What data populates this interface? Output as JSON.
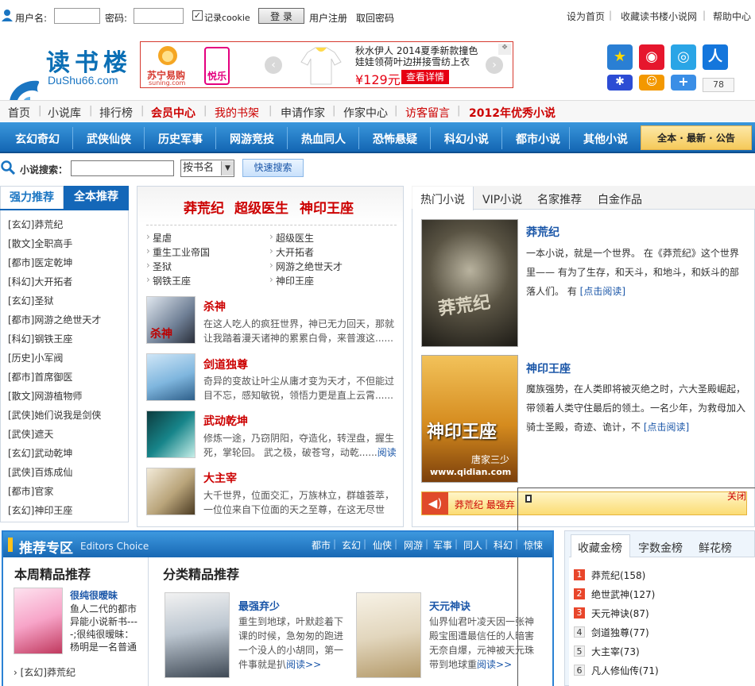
{
  "login": {
    "username_label": "用户名:",
    "password_label": "密码:",
    "remember_label": "记录cookie",
    "login_button": "登 录",
    "register_link": "用户注册",
    "forgot_link": "取回密码",
    "set_home": "设为首页",
    "bookmark": "收藏读书楼小说网",
    "help": "帮助中心"
  },
  "logo": {
    "text": "读书楼",
    "sub": "DuShu66.com"
  },
  "ad": {
    "brand": "苏宁易购",
    "brand_sub": "suning.com",
    "badge": "悦乐",
    "line1": "秋水伊人 2014夏季新款撞色",
    "line2": "娃娃领荷叶边拼接雪纺上衣",
    "price": "¥129元",
    "detail_button": "查看详情"
  },
  "social_count": "78",
  "nav_main": [
    "首页",
    "小说库",
    "排行榜",
    "会员中心",
    "我的书架",
    "申请作家",
    "作家中心",
    "访客留言",
    "2012年优秀小说"
  ],
  "nav_categories": [
    "玄幻奇幻",
    "武侠仙侠",
    "历史军事",
    "网游竞技",
    "热血同人",
    "恐怖悬疑",
    "科幻小说",
    "都市小说",
    "其他小说"
  ],
  "nav_right": "全本 · 最新 · 公告",
  "search": {
    "label": "小说搜索：",
    "select_value": "按书名",
    "button": "快速搜索"
  },
  "left_tabs": [
    "强力推荐",
    "全本推荐"
  ],
  "left_list": [
    "[玄幻]莽荒纪",
    "[散文]全职高手",
    "[都市]医定乾坤",
    "[科幻]大开拓者",
    "[玄幻]圣狱",
    "[都市]网游之绝世天才",
    "[科幻]钢铁王座",
    "[历史]小军阀",
    "[都市]首席御医",
    "[散文]网游植物师",
    "[武侠]她们说我是剑侠",
    "[武侠]遮天",
    "[玄幻]武动乾坤",
    "[武侠]百炼成仙",
    "[都市]官家",
    "[玄幻]神印王座"
  ],
  "middle": {
    "headline": [
      "莽荒纪",
      "超级医生",
      "神印王座"
    ],
    "links": [
      "星虐",
      "超级医生",
      "重生工业帝国",
      "大开拓者",
      "圣狱",
      "网游之绝世天才",
      "钢铁王座",
      "神印王座"
    ],
    "books": [
      {
        "title": "杀神",
        "desc": "在这人吃人的疯狂世界，神已无力回天，那就让我踏着漫天诸神的累累白骨，来普渡这......"
      },
      {
        "title": "剑道独尊",
        "desc": "奇异的变故让叶尘从庸才变为天才，不但能过目不忘，感知敏锐，领悟力更是直上云霄......"
      },
      {
        "title": "武动乾坤",
        "desc": "修炼一途，乃窃阴阳，夺造化，转涅盘，握生死，掌轮回。 武之极，破苍穹，动乾......",
        "read": "阅读"
      },
      {
        "title": "大主宰",
        "desc": "大千世界，位面交汇，万族林立，群雄荟萃，一位位来自下位面的天之至尊，在这无尽世"
      }
    ]
  },
  "right": {
    "tabs": [
      "热门小说",
      "VIP小说",
      "名家推荐",
      "白金作品"
    ],
    "books": [
      {
        "title": "莽荒纪",
        "desc": "一本小说，就是一个世界。 在《莽荒纪》这个世界里—— 有为了生存，和天斗，和地斗，和妖斗的部落人们。 有",
        "read": "[点击阅读]"
      },
      {
        "title": "神印王座",
        "desc": "魔族强势，在人类即将被灭绝之时，六大圣殿崛起，带领着人类守住最后的领土。一名少年，为救母加入骑士圣殿，奇迹、诡计，不",
        "read": "[点击阅读]"
      }
    ],
    "cover2_author": "唐家三少",
    "cover2_url": "www.qidian.com",
    "notice_text": "莽荒纪  最强弃",
    "close": "关闭"
  },
  "recommend": {
    "title": "推荐专区",
    "subtitle": "Editors Choice",
    "cats": [
      "都市",
      "玄幻",
      "仙侠",
      "网游",
      "军事",
      "同人",
      "科幻",
      "惊悚"
    ],
    "weekly_title": "本周精品推荐",
    "class_title": "分类精品推荐",
    "weekly_book": {
      "title": "很纯很暧昧",
      "desc": "鱼人二代的都市异能小说新书----;很纯很暧昧：杨明是一名普通"
    },
    "weekly_item": "[玄幻]莽荒纪",
    "class_books": [
      {
        "title": "最强弃少",
        "desc": "重生到地球，叶默趁着下课的时候，急匆匆的跑进一个没人的小胡同，第一件事就是扒",
        "read": "阅读>>"
      },
      {
        "title": "天元神诀",
        "desc": "仙界仙君叶凌天因一张神殿宝图遭最信任的人暗害无奈自爆，元神被天元珠带到地球重",
        "read": "阅读>>"
      }
    ]
  },
  "ranking": {
    "tabs": [
      "收藏金榜",
      "字数金榜",
      "鲜花榜"
    ],
    "items": [
      {
        "num": "1",
        "text": "莽荒纪(158)"
      },
      {
        "num": "2",
        "text": "绝世武神(127)"
      },
      {
        "num": "3",
        "text": "天元神诀(87)"
      },
      {
        "num": "4",
        "text": "剑道独尊(77)"
      },
      {
        "num": "5",
        "text": "大主宰(73)"
      },
      {
        "num": "6",
        "text": "凡人修仙传(71)"
      }
    ]
  },
  "colors": {
    "nav_blue": "#1a75c2",
    "accent_red": "#cc0000",
    "link_blue": "#1a56a8"
  }
}
